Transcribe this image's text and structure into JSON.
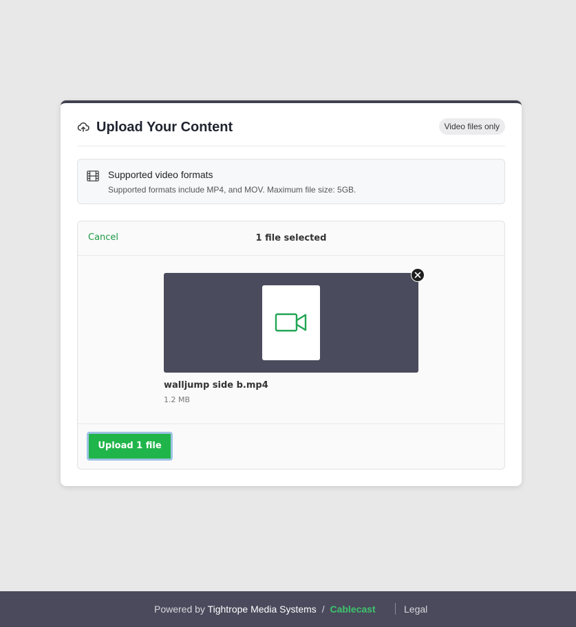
{
  "card": {
    "title": "Upload Your Content",
    "badge": "Video files only",
    "info": {
      "title": "Supported video formats",
      "description": "Supported formats include MP4, and MOV. Maximum file size: 5GB."
    }
  },
  "dashboard": {
    "cancel_label": "Cancel",
    "selected_text": "1 file selected",
    "file": {
      "name": "walljump side b.mp4",
      "size": "1.2 MB",
      "icon": "video-camera-icon"
    },
    "upload_button_label": "Upload 1 file"
  },
  "footer": {
    "powered_by": "Powered by",
    "company": "Tightrope Media Systems",
    "separator": "/",
    "brand": "Cablecast",
    "legal": "Legal"
  },
  "colors": {
    "accent_green": "#20b54a",
    "footer_bg": "#4a4a5c",
    "thumb_bg": "#4a4b5c"
  }
}
